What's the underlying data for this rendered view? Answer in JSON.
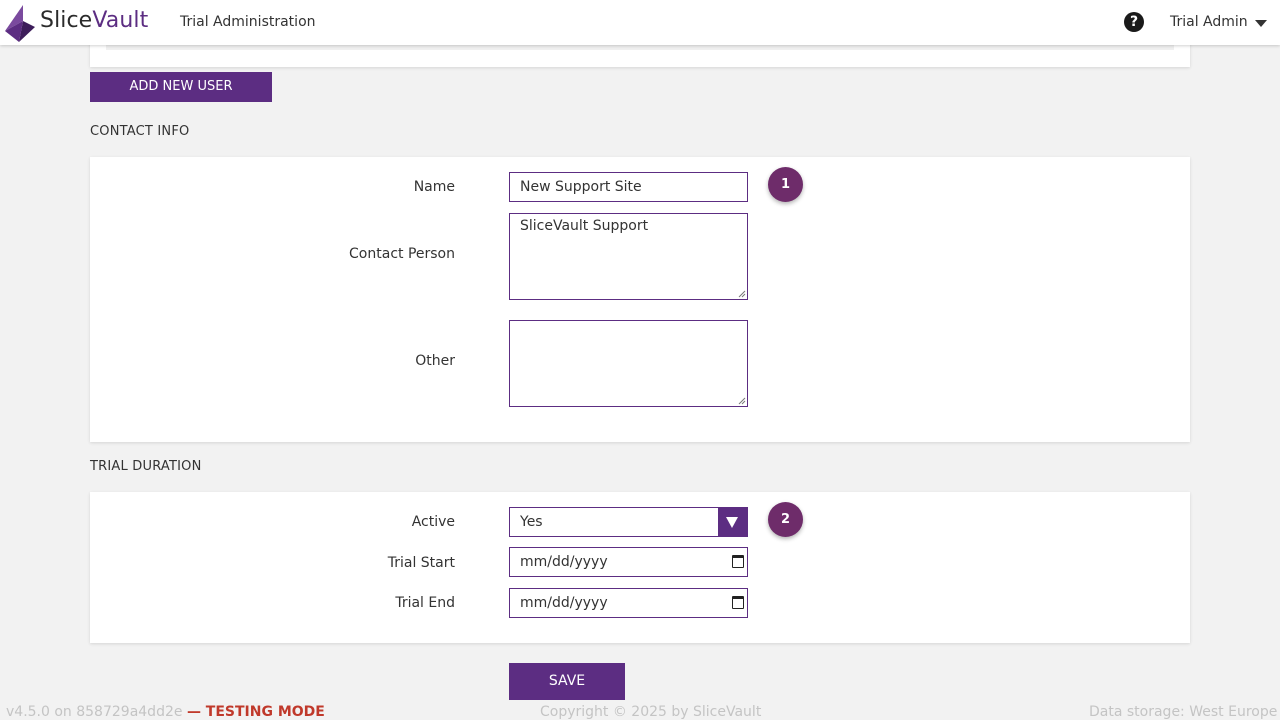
{
  "header": {
    "brand_a": "Slice",
    "brand_b": "Vault",
    "nav_title": "Trial Administration",
    "help_glyph": "?",
    "user_name": "Trial Admin"
  },
  "buttons": {
    "add_user": "ADD NEW USER",
    "save": "SAVE"
  },
  "contact": {
    "section_title": "CONTACT INFO",
    "name_label": "Name",
    "name_value": "New Support Site",
    "contact_label": "Contact Person",
    "contact_value": "SliceVault Support",
    "other_label": "Other",
    "other_value": "",
    "step": "1"
  },
  "trial": {
    "section_title": "TRIAL DURATION",
    "active_label": "Active",
    "active_value": "Yes",
    "start_label": "Trial Start",
    "start_value": "mm/dd/yyyy",
    "end_label": "Trial End",
    "end_value": "mm/dd/yyyy",
    "step": "2"
  },
  "footer": {
    "version": "v4.5.0 on 858729a4dd2e",
    "mode": "— TESTING MODE",
    "copyright": "Copyright © 2025 by SliceVault",
    "storage": "Data storage: West Europe"
  },
  "colors": {
    "accent": "#5c2d82",
    "badge": "#6e2c6a",
    "warning": "#c0392b",
    "background": "#f2f2f2"
  },
  "icons": {
    "logo": "slicevault-logo",
    "help": "help-icon",
    "user_menu": "caret-down-icon",
    "select": "dropdown-arrow-icon",
    "date": "calendar-icon"
  }
}
